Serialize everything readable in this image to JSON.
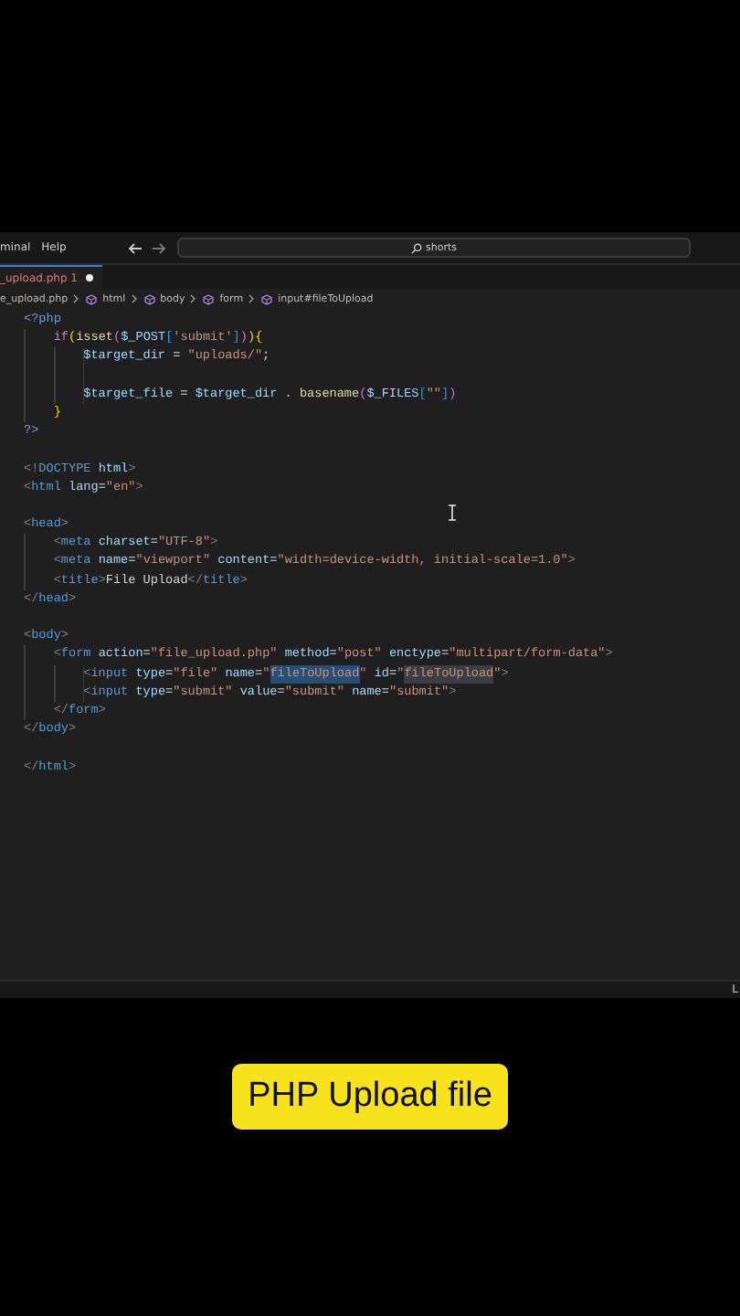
{
  "menu": [
    {
      "label": "minal"
    },
    {
      "label": "Help"
    }
  ],
  "search": {
    "value": "shorts"
  },
  "tab": {
    "label": "_upload.php",
    "badge": "1",
    "modified": true
  },
  "breadcrumb": [
    {
      "kind": "file",
      "label": "e_upload.php"
    },
    {
      "kind": "symbol",
      "label": "html"
    },
    {
      "kind": "symbol",
      "label": "body"
    },
    {
      "kind": "symbol",
      "label": "form"
    },
    {
      "kind": "symbol",
      "label": "input#fileToUpload"
    }
  ],
  "code": [
    {
      "kind": "code",
      "tokens": [
        {
          "kind": "phptag",
          "text": "<?php"
        }
      ]
    },
    {
      "kind": "code",
      "tokens": [
        {
          "kind": "kw",
          "text": "    if"
        },
        {
          "kind": "b1",
          "text": "("
        },
        {
          "kind": "fn",
          "text": "isset"
        },
        {
          "kind": "b2",
          "text": "("
        },
        {
          "kind": "var",
          "text": "$_POST"
        },
        {
          "kind": "b3",
          "text": "["
        },
        {
          "kind": "str",
          "text": "'submit'"
        },
        {
          "kind": "b3",
          "text": "]"
        },
        {
          "kind": "b2",
          "text": ")"
        },
        {
          "kind": "b1",
          "text": "){"
        }
      ]
    },
    {
      "kind": "code",
      "tokens": [
        {
          "kind": "var",
          "text": "        $target_dir"
        },
        {
          "kind": "text",
          "text": " = "
        },
        {
          "kind": "str",
          "text": "\"uploads/\""
        },
        {
          "kind": "text",
          "text": ";"
        }
      ]
    },
    {
      "kind": "blank"
    },
    {
      "kind": "code",
      "tokens": [
        {
          "kind": "var",
          "text": "        $target_file"
        },
        {
          "kind": "text",
          "text": " = "
        },
        {
          "kind": "var",
          "text": "$target_dir"
        },
        {
          "kind": "text",
          "text": " . "
        },
        {
          "kind": "fn",
          "text": "basename"
        },
        {
          "kind": "b2",
          "text": "("
        },
        {
          "kind": "var",
          "text": "$_FILES"
        },
        {
          "kind": "b3",
          "text": "["
        },
        {
          "kind": "str",
          "text": "\"\""
        },
        {
          "kind": "b3",
          "text": "]"
        },
        {
          "kind": "b2",
          "text": ")"
        }
      ]
    },
    {
      "kind": "code",
      "tokens": [
        {
          "kind": "b1",
          "text": "    }"
        }
      ]
    },
    {
      "kind": "code",
      "tokens": [
        {
          "kind": "phptag",
          "text": "?>"
        }
      ]
    },
    {
      "kind": "blank"
    },
    {
      "kind": "code",
      "tokens": [
        {
          "kind": "punct",
          "text": "<!"
        },
        {
          "kind": "tag",
          "text": "DOCTYPE"
        },
        {
          "kind": "attr",
          "text": " html"
        },
        {
          "kind": "punct",
          "text": ">"
        }
      ]
    },
    {
      "kind": "code",
      "tokens": [
        {
          "kind": "punct",
          "text": "<"
        },
        {
          "kind": "tag",
          "text": "html"
        },
        {
          "kind": "attr",
          "text": " lang"
        },
        {
          "kind": "text",
          "text": "="
        },
        {
          "kind": "str",
          "text": "\"en\""
        },
        {
          "kind": "punct",
          "text": ">"
        }
      ]
    },
    {
      "kind": "blank"
    },
    {
      "kind": "code",
      "tokens": [
        {
          "kind": "punct",
          "text": "<"
        },
        {
          "kind": "tag",
          "text": "head"
        },
        {
          "kind": "punct",
          "text": ">"
        }
      ]
    },
    {
      "kind": "code",
      "tokens": [
        {
          "kind": "punct",
          "text": "    <"
        },
        {
          "kind": "tag",
          "text": "meta"
        },
        {
          "kind": "attr",
          "text": " charset"
        },
        {
          "kind": "text",
          "text": "="
        },
        {
          "kind": "str",
          "text": "\"UTF-8\""
        },
        {
          "kind": "punct",
          "text": ">"
        }
      ]
    },
    {
      "kind": "code",
      "tokens": [
        {
          "kind": "punct",
          "text": "    <"
        },
        {
          "kind": "tag",
          "text": "meta"
        },
        {
          "kind": "attr",
          "text": " name"
        },
        {
          "kind": "text",
          "text": "="
        },
        {
          "kind": "str",
          "text": "\"viewport\""
        },
        {
          "kind": "attr",
          "text": " content"
        },
        {
          "kind": "text",
          "text": "="
        },
        {
          "kind": "str",
          "text": "\"width=device-width, initial-scale=1.0\""
        },
        {
          "kind": "punct",
          "text": ">"
        }
      ]
    },
    {
      "kind": "code",
      "tokens": [
        {
          "kind": "punct",
          "text": "    <"
        },
        {
          "kind": "tag",
          "text": "title"
        },
        {
          "kind": "punct",
          "text": ">"
        },
        {
          "kind": "text",
          "text": "File Upload"
        },
        {
          "kind": "punct",
          "text": "</"
        },
        {
          "kind": "tag",
          "text": "title"
        },
        {
          "kind": "punct",
          "text": ">"
        }
      ]
    },
    {
      "kind": "code",
      "tokens": [
        {
          "kind": "punct",
          "text": "</"
        },
        {
          "kind": "tag",
          "text": "head"
        },
        {
          "kind": "punct",
          "text": ">"
        }
      ]
    },
    {
      "kind": "blank"
    },
    {
      "kind": "code",
      "tokens": [
        {
          "kind": "punct",
          "text": "<"
        },
        {
          "kind": "tag",
          "text": "body"
        },
        {
          "kind": "punct",
          "text": ">"
        }
      ]
    },
    {
      "kind": "code",
      "tokens": [
        {
          "kind": "punct",
          "text": "    <"
        },
        {
          "kind": "tag",
          "text": "form"
        },
        {
          "kind": "attr",
          "text": " action"
        },
        {
          "kind": "text",
          "text": "="
        },
        {
          "kind": "str",
          "text": "\"file_upload.php\""
        },
        {
          "kind": "attr",
          "text": " method"
        },
        {
          "kind": "text",
          "text": "="
        },
        {
          "kind": "str",
          "text": "\"post\""
        },
        {
          "kind": "attr",
          "text": " enctype"
        },
        {
          "kind": "text",
          "text": "="
        },
        {
          "kind": "str",
          "text": "\"multipart/form-data\""
        },
        {
          "kind": "punct",
          "text": ">"
        }
      ]
    },
    {
      "kind": "code",
      "tokens": [
        {
          "kind": "punct",
          "text": "        <"
        },
        {
          "kind": "tag",
          "text": "input"
        },
        {
          "kind": "attr",
          "text": " type"
        },
        {
          "kind": "text",
          "text": "="
        },
        {
          "kind": "str",
          "text": "\"file\""
        },
        {
          "kind": "attr",
          "text": " name"
        },
        {
          "kind": "text",
          "text": "="
        },
        {
          "kind": "str",
          "text": "\""
        },
        {
          "kind": "selection",
          "text": "fileToUpload"
        },
        {
          "kind": "str",
          "text": "\""
        },
        {
          "kind": "attr",
          "text": " id"
        },
        {
          "kind": "text",
          "text": "="
        },
        {
          "kind": "str",
          "text": "\""
        },
        {
          "kind": "match",
          "text": "fileToUpload"
        },
        {
          "kind": "str",
          "text": "\""
        },
        {
          "kind": "punct",
          "text": ">"
        }
      ]
    },
    {
      "kind": "code",
      "tokens": [
        {
          "kind": "punct",
          "text": "        <"
        },
        {
          "kind": "tag",
          "text": "input"
        },
        {
          "kind": "attr",
          "text": " type"
        },
        {
          "kind": "text",
          "text": "="
        },
        {
          "kind": "str",
          "text": "\"submit\""
        },
        {
          "kind": "attr",
          "text": " value"
        },
        {
          "kind": "text",
          "text": "="
        },
        {
          "kind": "str",
          "text": "\"submit\""
        },
        {
          "kind": "attr",
          "text": " name"
        },
        {
          "kind": "text",
          "text": "="
        },
        {
          "kind": "str",
          "text": "\"submit\""
        },
        {
          "kind": "punct",
          "text": ">"
        }
      ]
    },
    {
      "kind": "code",
      "tokens": [
        {
          "kind": "punct",
          "text": "    </"
        },
        {
          "kind": "tag",
          "text": "form"
        },
        {
          "kind": "punct",
          "text": ">"
        }
      ]
    },
    {
      "kind": "code",
      "tokens": [
        {
          "kind": "punct",
          "text": "</"
        },
        {
          "kind": "tag",
          "text": "body"
        },
        {
          "kind": "punct",
          "text": ">"
        }
      ]
    },
    {
      "kind": "blank"
    },
    {
      "kind": "code",
      "tokens": [
        {
          "kind": "punct",
          "text": "</"
        },
        {
          "kind": "tag",
          "text": "html"
        },
        {
          "kind": "punct",
          "text": ">"
        }
      ]
    }
  ],
  "status_bar": {
    "text": "L"
  },
  "caption": "PHP Upload file"
}
